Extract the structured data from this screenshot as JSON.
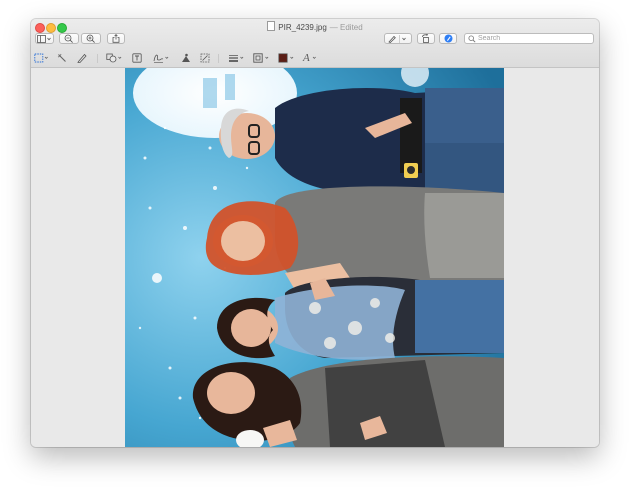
{
  "window": {
    "filename": "PIR_4239.jpg",
    "edited_label": "— Edited"
  },
  "toolbar": {
    "search_placeholder": "Search",
    "icons": [
      "sidebar-icon",
      "zoom-out-icon",
      "zoom-in-icon",
      "share-icon",
      "pen-markup-icon",
      "rotate-icon",
      "markup-toolbar-icon",
      "search-icon"
    ]
  },
  "markup_toolbar": {
    "icons": [
      "rectangular-selection-icon",
      "instant-alpha-icon",
      "sketch-icon",
      "shapes-icon",
      "text-icon",
      "sign-icon",
      "adjust-color-icon",
      "adjust-size-icon",
      "shape-style-icon",
      "border-color-icon",
      "fill-color-icon",
      "text-style-icon"
    ],
    "text_style_label": "A",
    "fill_color": "#5b1e16"
  },
  "photo": {
    "colors": {
      "background": "#3d9cc8",
      "shirt": "#1d2c4a",
      "jeans": "#3a5f8c",
      "red_hair": "#d2522a",
      "dark_hair": "#2b1a14",
      "skin": "#e8b79b"
    }
  }
}
